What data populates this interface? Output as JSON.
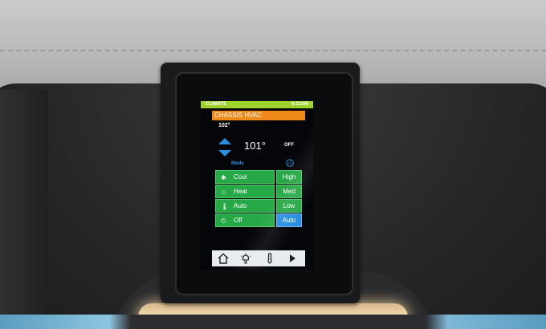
{
  "status_bar": {
    "title": "CLIMATE",
    "time": "6:11AM"
  },
  "header": {
    "title": "CHASSIS HVAC"
  },
  "temperature": {
    "ambient": "102°",
    "setpoint": "101°"
  },
  "fan": {
    "state": "OFF"
  },
  "mode_label": "Mode",
  "modes": [
    {
      "label": "Cool",
      "icon": "snowflake-icon"
    },
    {
      "label": "Heat",
      "icon": "heat-icon"
    },
    {
      "label": "Auto",
      "icon": "thermometer-icon"
    },
    {
      "label": "Off",
      "icon": "power-icon"
    }
  ],
  "fan_speeds": [
    {
      "label": "High",
      "active": false
    },
    {
      "label": "Med",
      "active": false
    },
    {
      "label": "Low",
      "active": false
    },
    {
      "label": "Auto",
      "active": true
    }
  ],
  "nav": [
    "home-icon",
    "light-icon",
    "thermometer-icon",
    "next-arrow-icon"
  ],
  "colors": {
    "status_bar": "#9fd22c",
    "header": "#f08a1a",
    "button": "#27a847",
    "active": "#2a8fe0"
  }
}
